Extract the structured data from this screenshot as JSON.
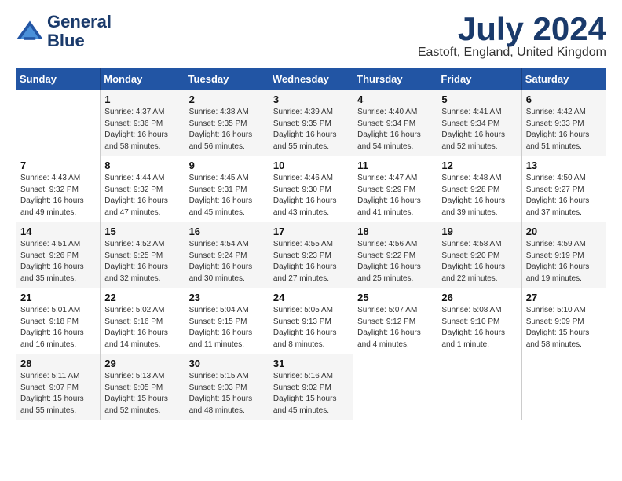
{
  "header": {
    "logo_line1": "General",
    "logo_line2": "Blue",
    "month_title": "July 2024",
    "location": "Eastoft, England, United Kingdom"
  },
  "weekdays": [
    "Sunday",
    "Monday",
    "Tuesday",
    "Wednesday",
    "Thursday",
    "Friday",
    "Saturday"
  ],
  "weeks": [
    [
      {
        "day": "",
        "info": ""
      },
      {
        "day": "1",
        "info": "Sunrise: 4:37 AM\nSunset: 9:36 PM\nDaylight: 16 hours\nand 58 minutes."
      },
      {
        "day": "2",
        "info": "Sunrise: 4:38 AM\nSunset: 9:35 PM\nDaylight: 16 hours\nand 56 minutes."
      },
      {
        "day": "3",
        "info": "Sunrise: 4:39 AM\nSunset: 9:35 PM\nDaylight: 16 hours\nand 55 minutes."
      },
      {
        "day": "4",
        "info": "Sunrise: 4:40 AM\nSunset: 9:34 PM\nDaylight: 16 hours\nand 54 minutes."
      },
      {
        "day": "5",
        "info": "Sunrise: 4:41 AM\nSunset: 9:34 PM\nDaylight: 16 hours\nand 52 minutes."
      },
      {
        "day": "6",
        "info": "Sunrise: 4:42 AM\nSunset: 9:33 PM\nDaylight: 16 hours\nand 51 minutes."
      }
    ],
    [
      {
        "day": "7",
        "info": "Sunrise: 4:43 AM\nSunset: 9:32 PM\nDaylight: 16 hours\nand 49 minutes."
      },
      {
        "day": "8",
        "info": "Sunrise: 4:44 AM\nSunset: 9:32 PM\nDaylight: 16 hours\nand 47 minutes."
      },
      {
        "day": "9",
        "info": "Sunrise: 4:45 AM\nSunset: 9:31 PM\nDaylight: 16 hours\nand 45 minutes."
      },
      {
        "day": "10",
        "info": "Sunrise: 4:46 AM\nSunset: 9:30 PM\nDaylight: 16 hours\nand 43 minutes."
      },
      {
        "day": "11",
        "info": "Sunrise: 4:47 AM\nSunset: 9:29 PM\nDaylight: 16 hours\nand 41 minutes."
      },
      {
        "day": "12",
        "info": "Sunrise: 4:48 AM\nSunset: 9:28 PM\nDaylight: 16 hours\nand 39 minutes."
      },
      {
        "day": "13",
        "info": "Sunrise: 4:50 AM\nSunset: 9:27 PM\nDaylight: 16 hours\nand 37 minutes."
      }
    ],
    [
      {
        "day": "14",
        "info": "Sunrise: 4:51 AM\nSunset: 9:26 PM\nDaylight: 16 hours\nand 35 minutes."
      },
      {
        "day": "15",
        "info": "Sunrise: 4:52 AM\nSunset: 9:25 PM\nDaylight: 16 hours\nand 32 minutes."
      },
      {
        "day": "16",
        "info": "Sunrise: 4:54 AM\nSunset: 9:24 PM\nDaylight: 16 hours\nand 30 minutes."
      },
      {
        "day": "17",
        "info": "Sunrise: 4:55 AM\nSunset: 9:23 PM\nDaylight: 16 hours\nand 27 minutes."
      },
      {
        "day": "18",
        "info": "Sunrise: 4:56 AM\nSunset: 9:22 PM\nDaylight: 16 hours\nand 25 minutes."
      },
      {
        "day": "19",
        "info": "Sunrise: 4:58 AM\nSunset: 9:20 PM\nDaylight: 16 hours\nand 22 minutes."
      },
      {
        "day": "20",
        "info": "Sunrise: 4:59 AM\nSunset: 9:19 PM\nDaylight: 16 hours\nand 19 minutes."
      }
    ],
    [
      {
        "day": "21",
        "info": "Sunrise: 5:01 AM\nSunset: 9:18 PM\nDaylight: 16 hours\nand 16 minutes."
      },
      {
        "day": "22",
        "info": "Sunrise: 5:02 AM\nSunset: 9:16 PM\nDaylight: 16 hours\nand 14 minutes."
      },
      {
        "day": "23",
        "info": "Sunrise: 5:04 AM\nSunset: 9:15 PM\nDaylight: 16 hours\nand 11 minutes."
      },
      {
        "day": "24",
        "info": "Sunrise: 5:05 AM\nSunset: 9:13 PM\nDaylight: 16 hours\nand 8 minutes."
      },
      {
        "day": "25",
        "info": "Sunrise: 5:07 AM\nSunset: 9:12 PM\nDaylight: 16 hours\nand 4 minutes."
      },
      {
        "day": "26",
        "info": "Sunrise: 5:08 AM\nSunset: 9:10 PM\nDaylight: 16 hours\nand 1 minute."
      },
      {
        "day": "27",
        "info": "Sunrise: 5:10 AM\nSunset: 9:09 PM\nDaylight: 15 hours\nand 58 minutes."
      }
    ],
    [
      {
        "day": "28",
        "info": "Sunrise: 5:11 AM\nSunset: 9:07 PM\nDaylight: 15 hours\nand 55 minutes."
      },
      {
        "day": "29",
        "info": "Sunrise: 5:13 AM\nSunset: 9:05 PM\nDaylight: 15 hours\nand 52 minutes."
      },
      {
        "day": "30",
        "info": "Sunrise: 5:15 AM\nSunset: 9:03 PM\nDaylight: 15 hours\nand 48 minutes."
      },
      {
        "day": "31",
        "info": "Sunrise: 5:16 AM\nSunset: 9:02 PM\nDaylight: 15 hours\nand 45 minutes."
      },
      {
        "day": "",
        "info": ""
      },
      {
        "day": "",
        "info": ""
      },
      {
        "day": "",
        "info": ""
      }
    ]
  ]
}
